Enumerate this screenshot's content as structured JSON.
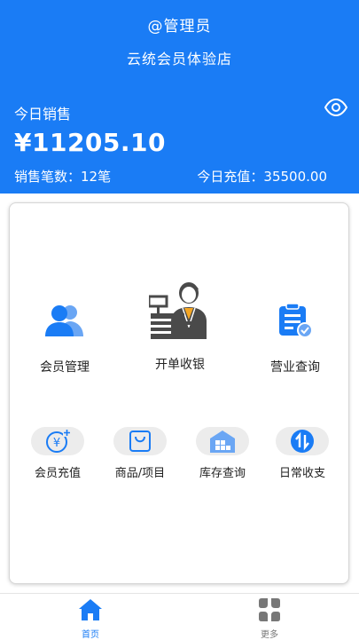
{
  "header": {
    "admin_name": "@管理员",
    "store_name": "云统会员体验店",
    "sales_label": "今日销售",
    "sales_amount": "¥11205.10",
    "order_count": "销售笔数：12笔",
    "recharge": "今日充值：35500.00",
    "icons": {
      "visibility": "eye-icon"
    }
  },
  "main_menu": [
    {
      "label": "会员管理",
      "icon": "members-icon"
    },
    {
      "label": "开单收银",
      "icon": "cashier-icon"
    },
    {
      "label": "营业查询",
      "icon": "clipboard-check-icon"
    }
  ],
  "sub_menu": [
    {
      "label": "会员充值",
      "icon": "yen-plus-icon"
    },
    {
      "label": "商品/项目",
      "icon": "shopping-bag-icon"
    },
    {
      "label": "库存查询",
      "icon": "warehouse-icon"
    },
    {
      "label": "日常收支",
      "icon": "income-expense-icon"
    }
  ],
  "tabbar": {
    "home": "首页",
    "more": "更多"
  },
  "colors": {
    "primary": "#1a7cf5",
    "icon_gray": "#4a4a4a",
    "tab_inactive": "#777777"
  }
}
